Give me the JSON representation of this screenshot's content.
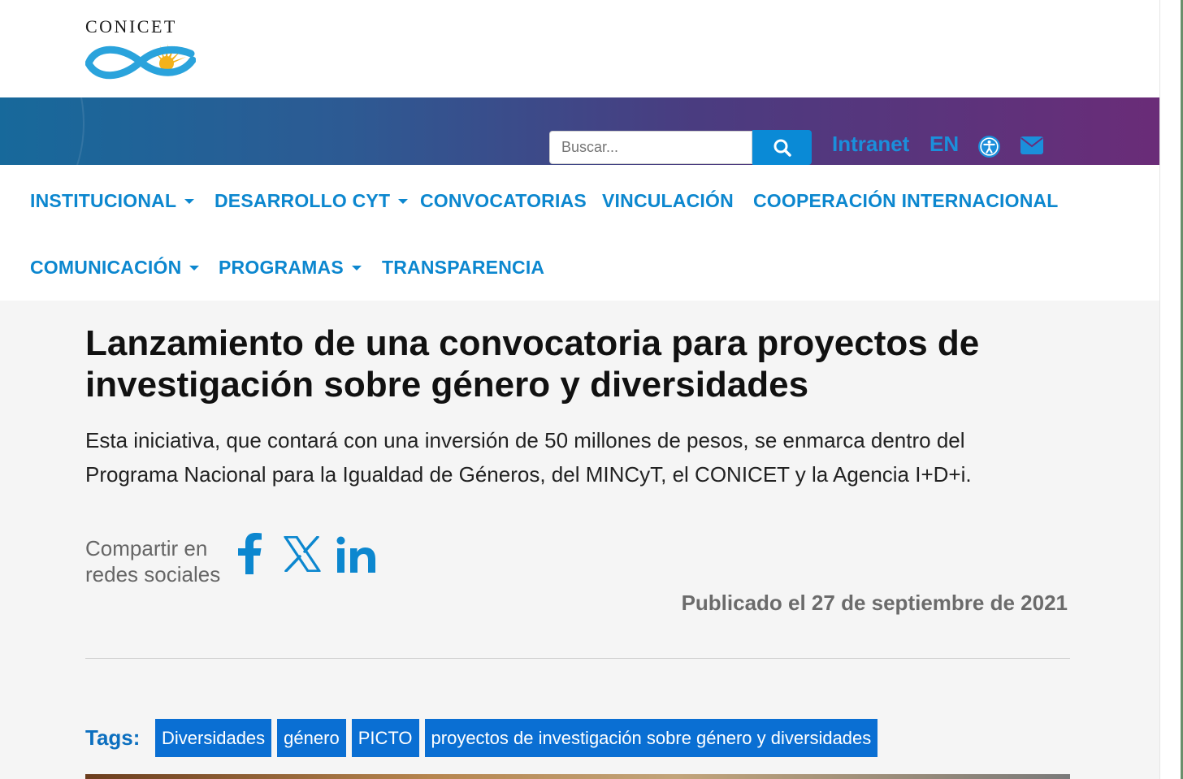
{
  "header": {
    "logo_text": "CONICET",
    "search_placeholder": "Buscar...",
    "links": {
      "intranet": "Intranet",
      "language": "EN"
    },
    "icons": {
      "search": "search-icon",
      "accessibility": "accessibility-icon",
      "mail": "mail-icon"
    }
  },
  "nav": {
    "row1": [
      {
        "label": "INSTITUCIONAL",
        "dropdown": true
      },
      {
        "label": "DESARROLLO CYT",
        "dropdown": true
      },
      {
        "label": "CONVOCATORIAS",
        "dropdown": false
      },
      {
        "label": "VINCULACIÓN",
        "dropdown": false
      },
      {
        "label": "COOPERACIÓN INTERNACIONAL",
        "dropdown": false
      }
    ],
    "row2": [
      {
        "label": "COMUNICACIÓN",
        "dropdown": true
      },
      {
        "label": "PROGRAMAS",
        "dropdown": true
      },
      {
        "label": "TRANSPARENCIA",
        "dropdown": false
      }
    ]
  },
  "article": {
    "title": "Lanzamiento de una convocatoria para proyectos de investigación sobre género y diversidades",
    "lede": "Esta iniciativa, que contará con una inversión de 50 millones de pesos, se enmarca dentro del Programa Nacional para la Igualdad de Géneros, del MINCyT, el CONICET y la Agencia I+D+i.",
    "share_label": "Compartir en redes sociales",
    "share_icons": [
      "facebook-icon",
      "x-icon",
      "linkedin-icon"
    ],
    "published": "Publicado el 27 de septiembre de 2021",
    "tags_label": "Tags:",
    "tags": [
      "Diversidades",
      "género",
      "PICTO",
      "proyectos de investigación sobre género y diversidades"
    ]
  },
  "colors": {
    "accent": "#0c87cf",
    "tag_bg": "#0a6fd3",
    "banner_start": "#17699b",
    "banner_end": "#6a2c78"
  }
}
